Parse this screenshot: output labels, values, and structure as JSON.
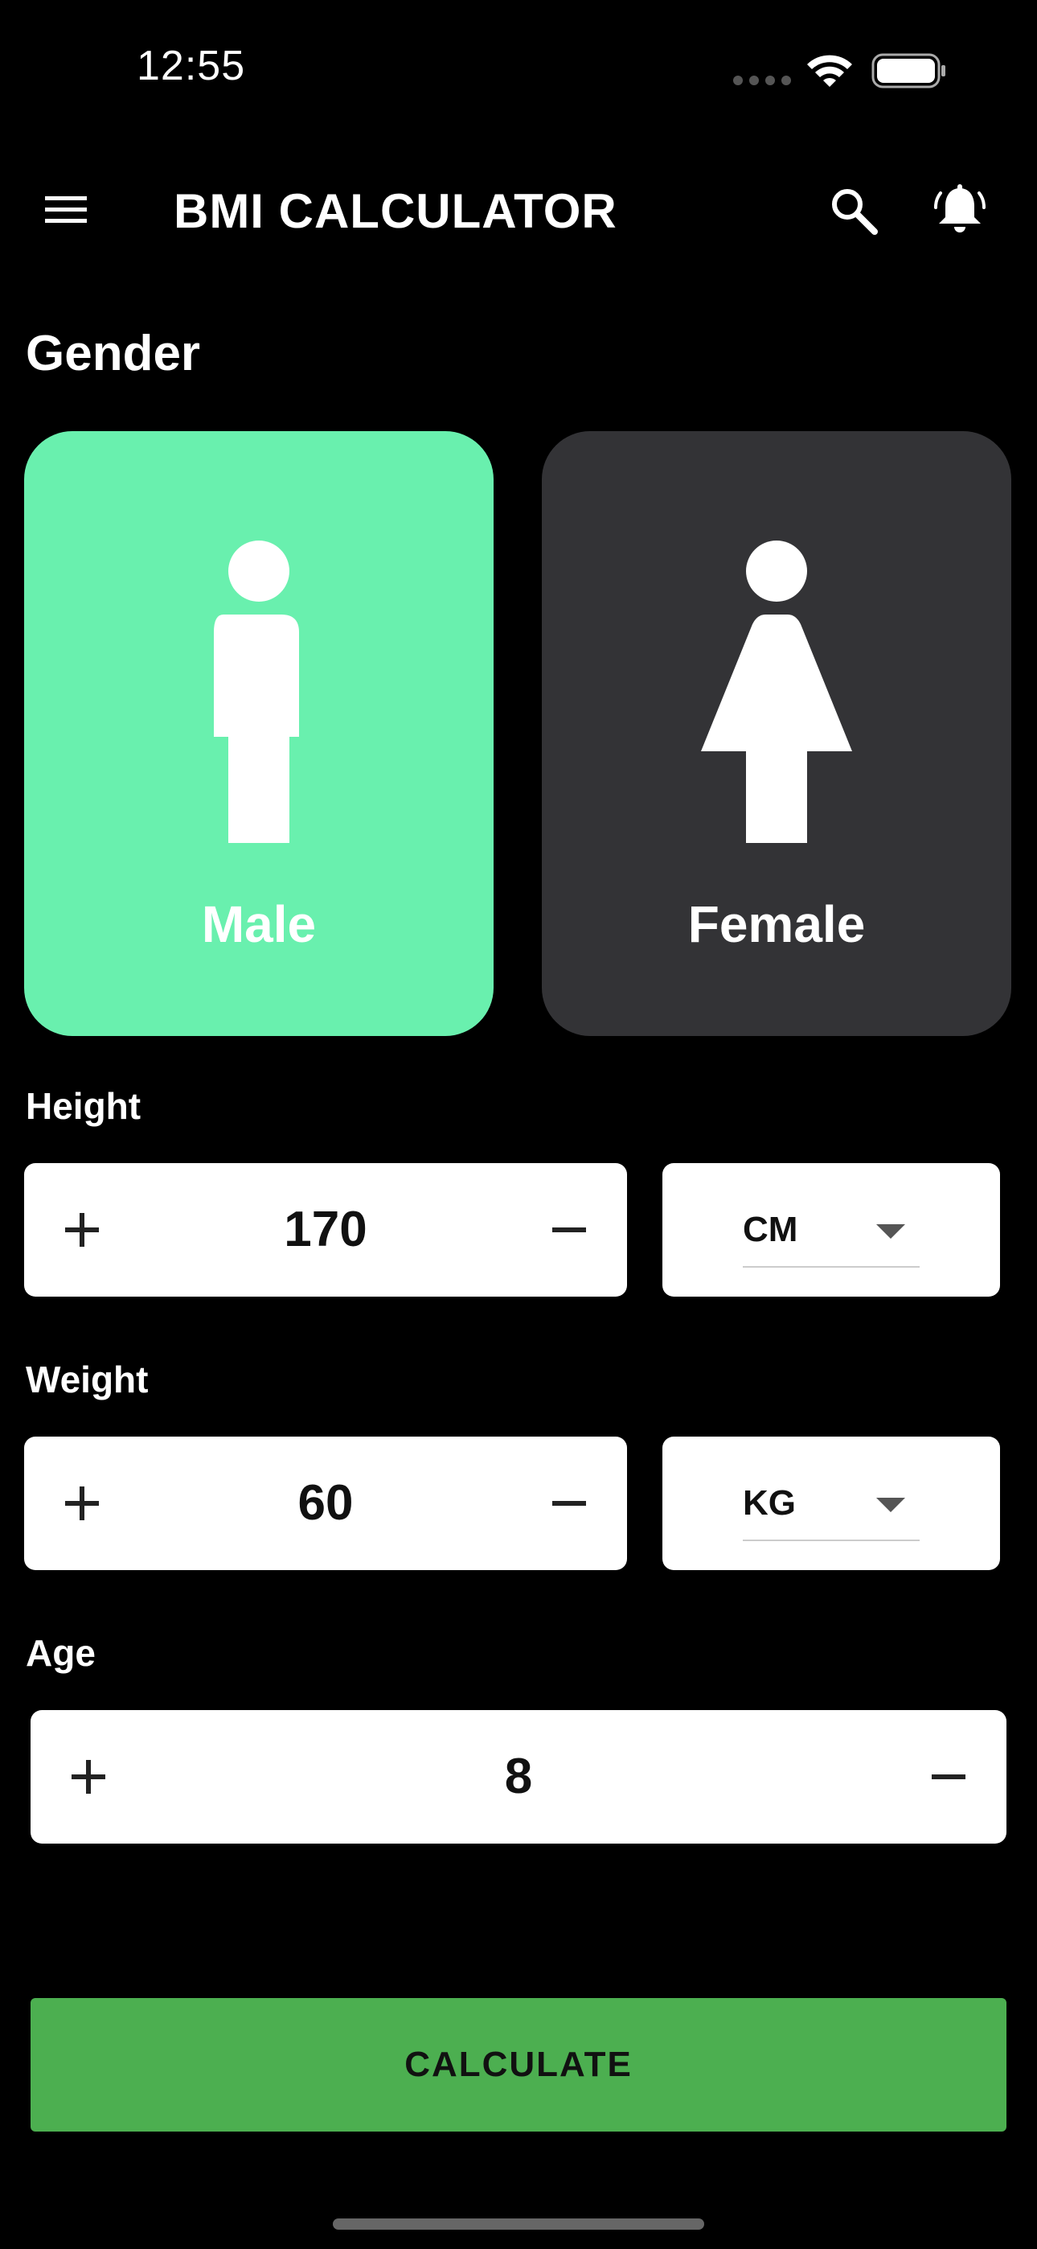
{
  "status_bar": {
    "time": "12:55"
  },
  "app_bar": {
    "title": "BMI CALCULATOR",
    "icons": [
      "menu-icon",
      "search-icon",
      "bell-icon"
    ]
  },
  "gender": {
    "label": "Gender",
    "options": [
      {
        "label": "Male",
        "selected": true,
        "color": "#69f0ae"
      },
      {
        "label": "Female",
        "selected": false,
        "color": "#333336"
      }
    ]
  },
  "height": {
    "label": "Height",
    "value": "170",
    "unit": "CM",
    "increment_icon": "plus-icon",
    "decrement_icon": "minus-icon"
  },
  "weight": {
    "label": "Weight",
    "value": "60",
    "unit": "KG",
    "increment_icon": "plus-icon",
    "decrement_icon": "minus-icon"
  },
  "age": {
    "label": "Age",
    "value": "8",
    "increment_icon": "plus-icon",
    "decrement_icon": "minus-icon"
  },
  "actions": {
    "calculate_label": "CALCULATE",
    "calculate_color": "#4caf50"
  }
}
